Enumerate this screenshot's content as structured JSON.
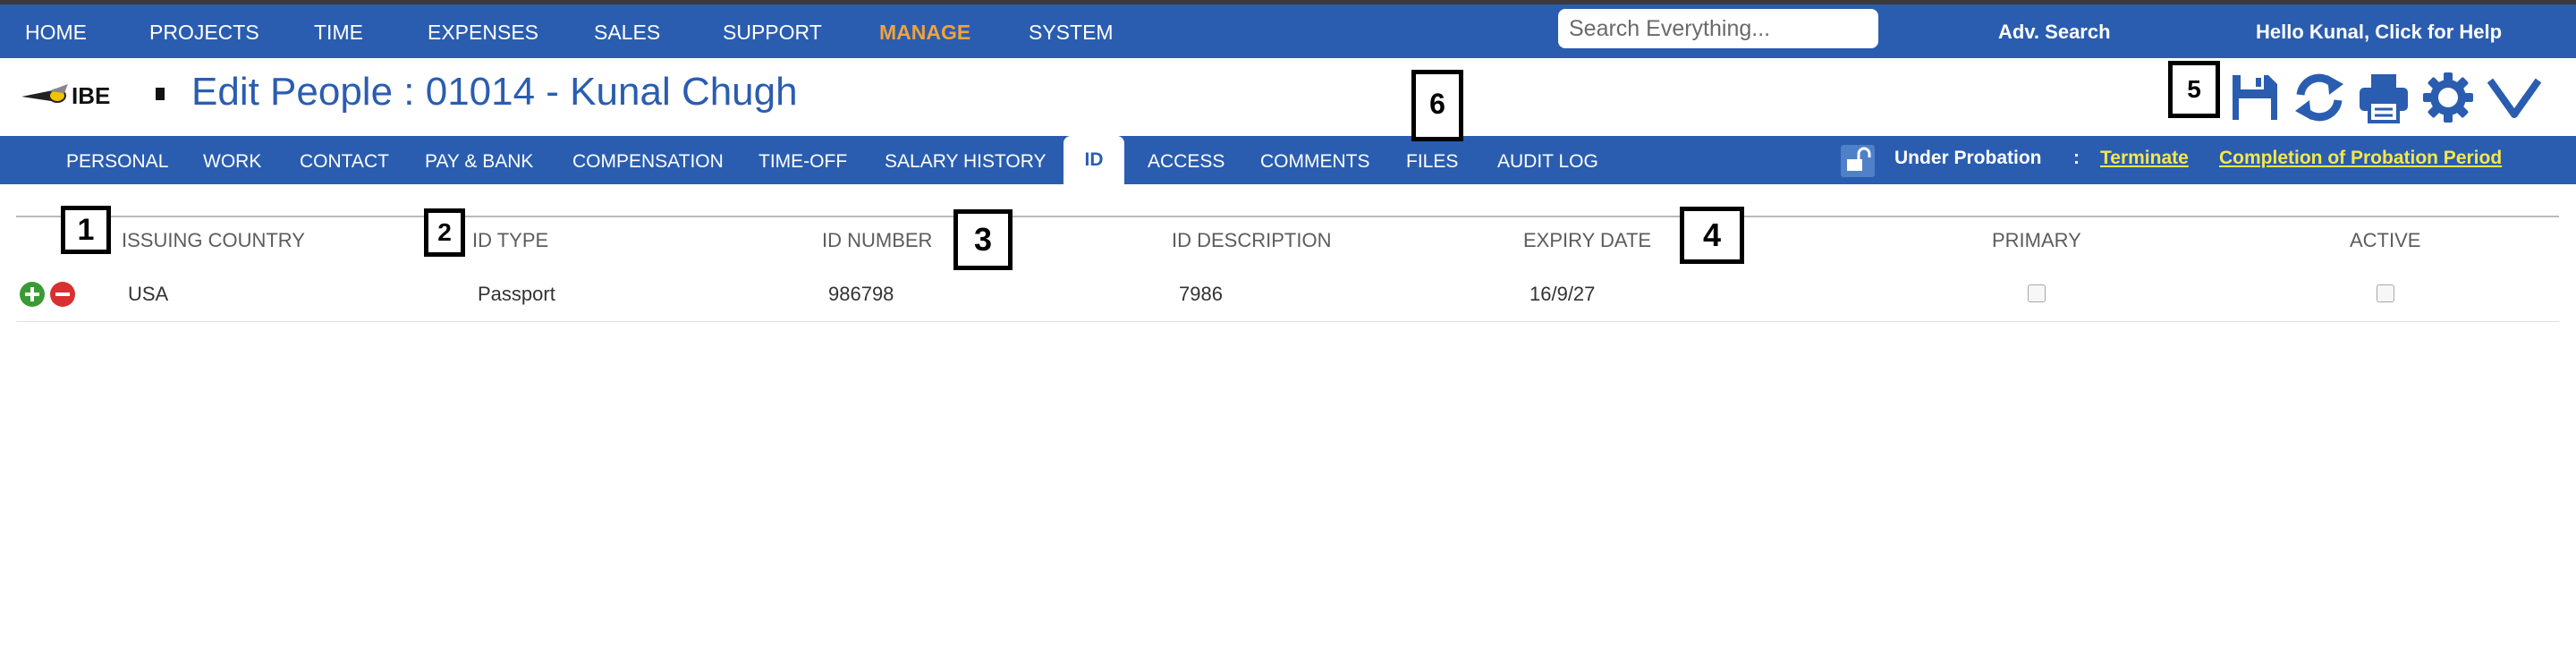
{
  "nav": {
    "items": [
      "HOME",
      "PROJECTS",
      "TIME",
      "EXPENSES",
      "SALES",
      "SUPPORT",
      "MANAGE",
      "SYSTEM"
    ],
    "active": "MANAGE",
    "search_placeholder": "Search Everything...",
    "adv_search": "Adv. Search",
    "greeting": "Hello Kunal, Click for Help"
  },
  "header": {
    "logo_text": "IBE",
    "title": "Edit People : 01014 - Kunal Chugh"
  },
  "toolbar": {
    "icons": [
      "save-icon",
      "refresh-icon",
      "print-icon",
      "settings-gear-icon",
      "collapse-chevron-icon"
    ]
  },
  "tabs": {
    "items": [
      "PERSONAL",
      "WORK",
      "CONTACT",
      "PAY & BANK",
      "COMPENSATION",
      "TIME-OFF",
      "SALARY HISTORY",
      "ID",
      "ACCESS",
      "COMMENTS",
      "FILES",
      "AUDIT LOG"
    ],
    "active": "ID"
  },
  "probation": {
    "status": "Under Probation",
    "separator": ":",
    "terminate": "Terminate",
    "completion": "Completion of Probation Period"
  },
  "table": {
    "columns": [
      "ISSUING COUNTRY",
      "ID TYPE",
      "ID NUMBER",
      "ID DESCRIPTION",
      "EXPIRY DATE",
      "PRIMARY",
      "ACTIVE"
    ],
    "rows": [
      {
        "country": "USA",
        "id_type": "Passport",
        "id_number": "986798",
        "description": "7986",
        "expiry": "16/9/27",
        "primary": false,
        "active": false
      }
    ]
  },
  "markers": [
    "1",
    "2",
    "3",
    "4",
    "5",
    "6"
  ],
  "colors": {
    "brand_blue": "#2a5db0",
    "accent_orange": "#f0a23c",
    "link_yellow": "#f4e84a",
    "add_green": "#3a9a34",
    "remove_red": "#d83030"
  }
}
